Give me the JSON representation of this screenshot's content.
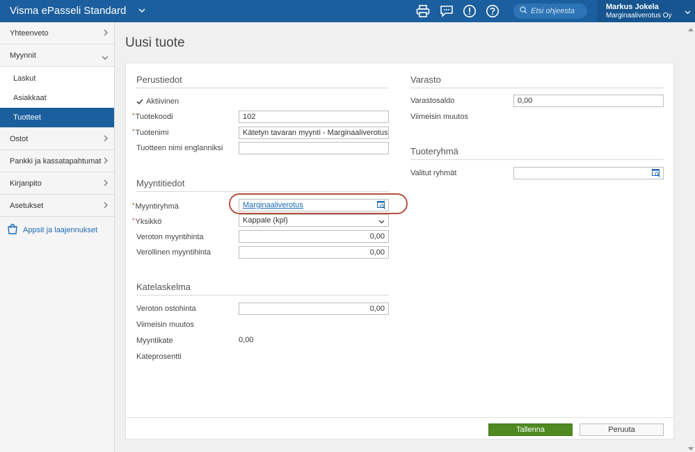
{
  "app": {
    "title": "Visma ePasseli Standard"
  },
  "header": {
    "search_placeholder": "Etsi ohjeesta",
    "user_name": "Markus Jokela",
    "company": "Marginaaliverotus Oy"
  },
  "sidebar": {
    "items": [
      {
        "label": "Yhteenveto"
      },
      {
        "label": "Myynnit"
      },
      {
        "label": "Ostot"
      },
      {
        "label": "Pankki ja kassatapahtumat"
      },
      {
        "label": "Kirjanpito"
      },
      {
        "label": "Asetukset"
      }
    ],
    "myynnit_sub": [
      {
        "label": "Laskut"
      },
      {
        "label": "Asiakkaat"
      },
      {
        "label": "Tuotteet"
      }
    ],
    "apps_label": "Appsit ja laajennukset"
  },
  "page": {
    "title": "Uusi tuote"
  },
  "perustiedot": {
    "title": "Perustiedot",
    "active_label": "Aktiivinen",
    "active": true,
    "code_label": "Tuotekoodi",
    "code_value": "102",
    "name_label": "Tuotenimi",
    "name_value": "Kätetyn tavaran myynti - Marginaaliverotus",
    "name_en_label": "Tuotteen nimi englanniksi",
    "name_en_value": ""
  },
  "myyntitiedot": {
    "title": "Myyntitiedot",
    "group_label": "Myyntiryhmä",
    "group_value": "Marginaaliverotus",
    "unit_label": "Yksikkö",
    "unit_value": "Kappale (kpl)",
    "net_price_label": "Veroton myyntihinta",
    "net_price_value": "0,00",
    "gross_price_label": "Verollinen myyntihinta",
    "gross_price_value": "0,00"
  },
  "katelaskelma": {
    "title": "Katelaskelma",
    "purchase_label": "Veroton ostohinta",
    "purchase_value": "0,00",
    "last_change_label": "Viimeisin muutos",
    "margin_label": "Myyntikate",
    "margin_value": "0,00",
    "margin_pct_label": "Kateprosentti"
  },
  "varasto": {
    "title": "Varasto",
    "balance_label": "Varastosaldo",
    "balance_value": "0,00",
    "last_change_label": "Viimeisin muutos"
  },
  "tuoteryhma": {
    "title": "Tuoteryhmä",
    "selected_label": "Valitut ryhmät",
    "selected_value": ""
  },
  "actions": {
    "save": "Tallenna",
    "cancel": "Peruuta"
  },
  "colors": {
    "brand": "#1c5f9e",
    "save": "#4e8a21",
    "highlight": "#b5503c",
    "required": "#c0392b"
  }
}
